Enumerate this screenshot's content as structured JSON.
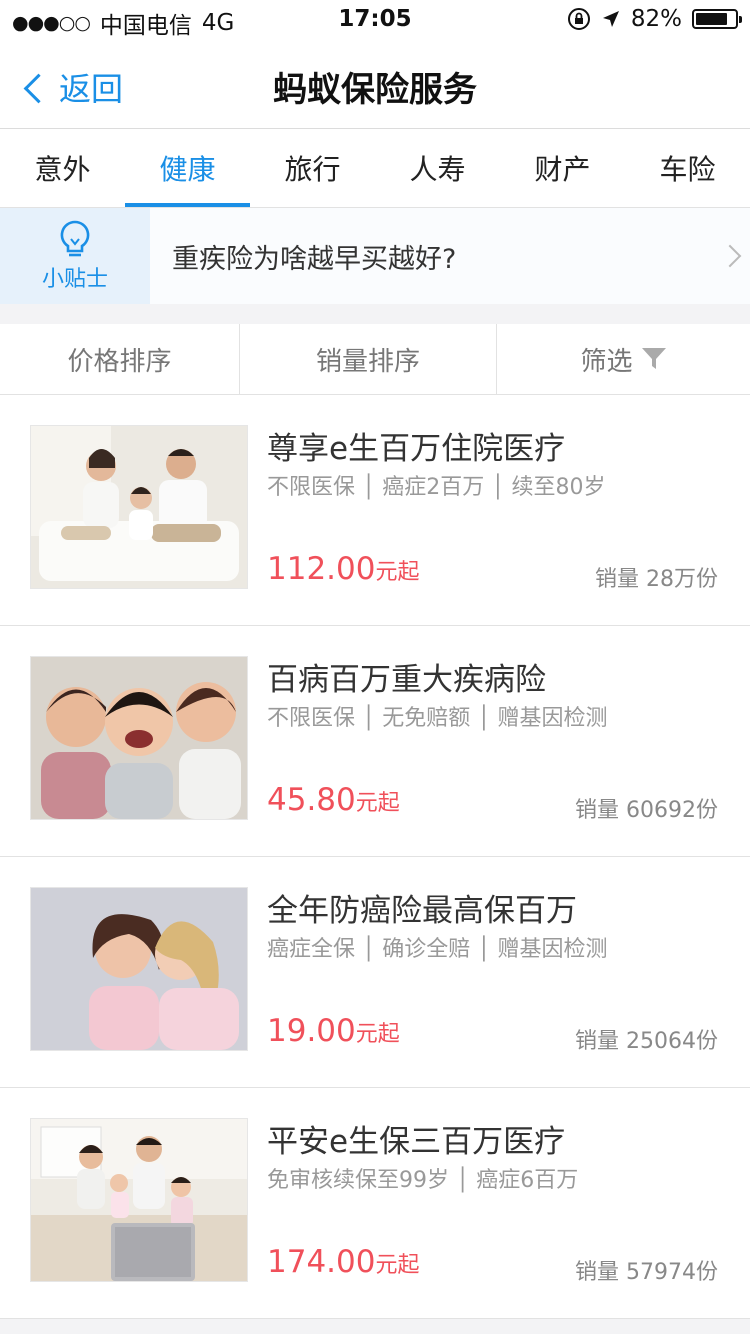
{
  "status": {
    "signal": "●●●○○",
    "carrier": "中国电信",
    "network": "4G",
    "time": "17:05",
    "battery_text": "82%",
    "battery_level": 0.82
  },
  "nav": {
    "back_label": "返回",
    "title": "蚂蚁保险服务"
  },
  "tabs": [
    {
      "label": "意外",
      "active": false
    },
    {
      "label": "健康",
      "active": true
    },
    {
      "label": "旅行",
      "active": false
    },
    {
      "label": "人寿",
      "active": false
    },
    {
      "label": "财产",
      "active": false
    },
    {
      "label": "车险",
      "active": false
    }
  ],
  "tip": {
    "badge_label": "小贴士",
    "text": "重疾险为啥越早买越好?"
  },
  "sort": {
    "price": "价格排序",
    "sales": "销量排序",
    "filter": "筛选"
  },
  "products": [
    {
      "name": "尊享e生百万住院医疗",
      "tags": "不限医保 │ 癌症2百万 │ 续至80岁",
      "price": "112.00",
      "price_suffix": "元起",
      "sales": "销量 28万份"
    },
    {
      "name": "百病百万重大疾病险",
      "tags": "不限医保 │ 无免赔额 │ 赠基因检测",
      "price": "45.80",
      "price_suffix": "元起",
      "sales": "销量 60692份"
    },
    {
      "name": "全年防癌险最高保百万",
      "tags": "癌症全保 │ 确诊全赔 │ 赠基因检测",
      "price": "19.00",
      "price_suffix": "元起",
      "sales": "销量 25064份"
    },
    {
      "name": "平安e生保三百万医疗",
      "tags": "免审核续保至99岁 │ 癌症6百万",
      "price": "174.00",
      "price_suffix": "元起",
      "sales": "销量 57974份"
    }
  ],
  "colors": {
    "accent": "#1a8fe6",
    "price": "#f0505a"
  }
}
